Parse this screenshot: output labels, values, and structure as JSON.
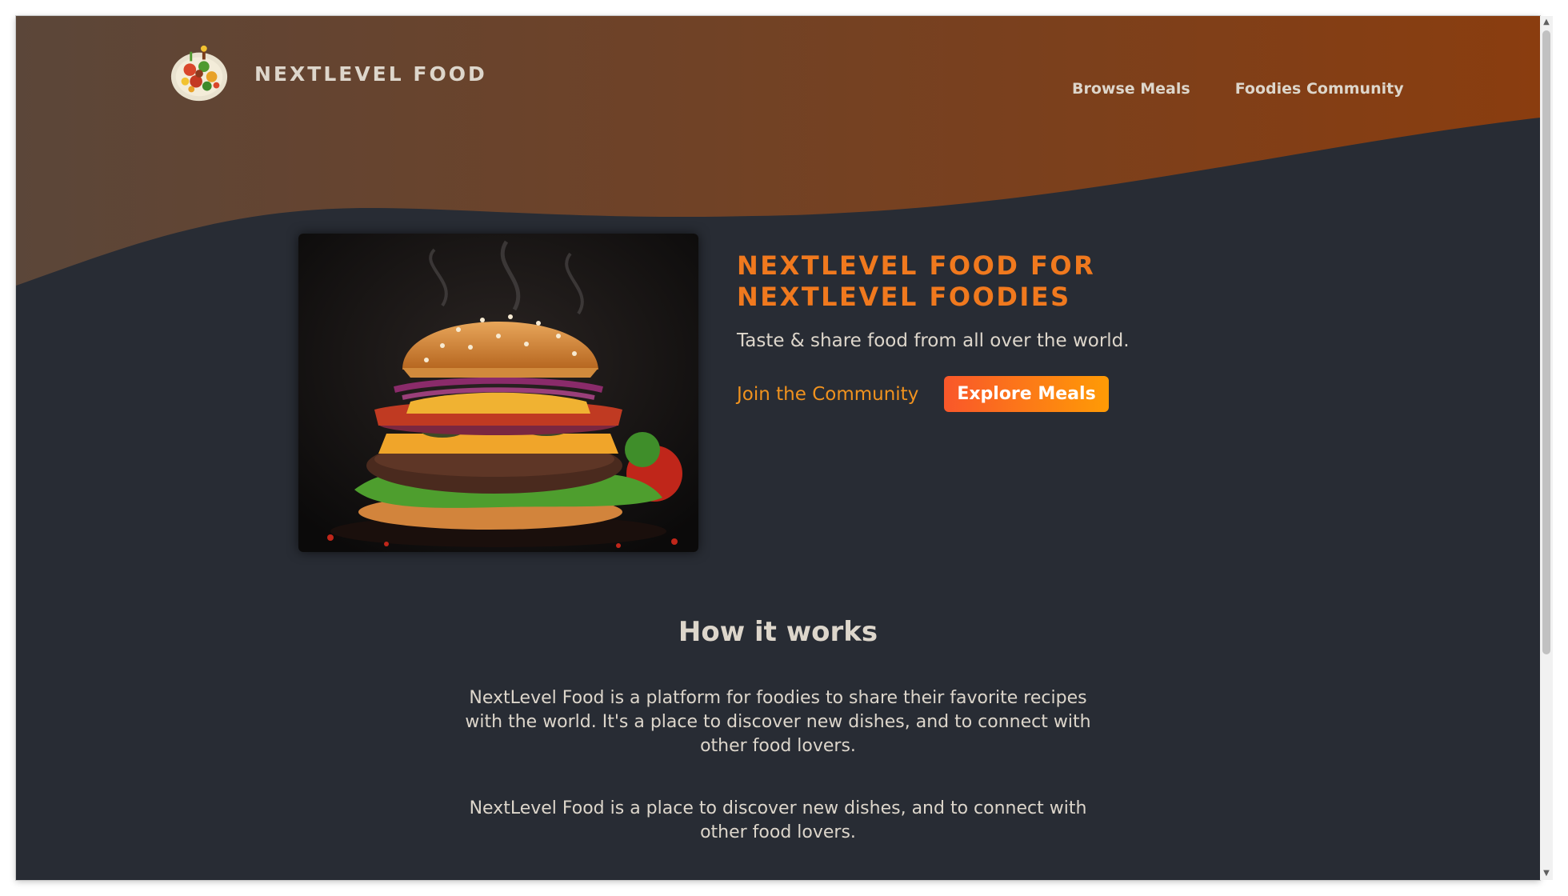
{
  "header": {
    "logo_text": "NEXTLEVEL FOOD",
    "nav": [
      {
        "label": "Browse Meals"
      },
      {
        "label": "Foodies Community"
      }
    ]
  },
  "hero": {
    "title": "NextLevel Food for NextLevel Foodies",
    "subtitle": "Taste & share food from all over the world.",
    "join_label": "Join the Community",
    "explore_label": "Explore Meals"
  },
  "how_it_works": {
    "title": "How it works",
    "paragraphs": [
      "NextLevel Food is a platform for foodies to share their favorite recipes with the world. It's a place to discover new dishes, and to connect with other food lovers.",
      "NextLevel Food is a place to discover new dishes, and to connect with other food lovers."
    ]
  },
  "icons": {
    "logo": "food-plate-logo-icon",
    "hero_image": "burger-image",
    "scroll_up": "scroll-up-arrow-icon",
    "scroll_down": "scroll-down-arrow-icon"
  },
  "colors": {
    "background": "#282c34",
    "gradient_start": "#5b4639",
    "gradient_end": "#8a3d0f",
    "accent": "#f0791e",
    "button_start": "#f9572a",
    "button_end": "#ff9b05",
    "text": "#ddd6cb"
  }
}
